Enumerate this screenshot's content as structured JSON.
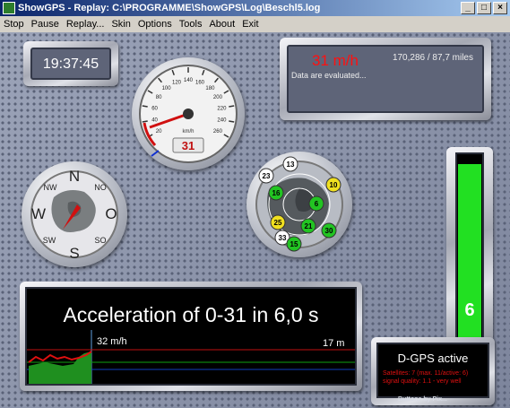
{
  "window": {
    "title": "ShowGPS - Replay: C:\\PROGRAMME\\ShowGPS\\Log\\Beschl5.log",
    "buttons": {
      "minimize": "_",
      "maximize": "□",
      "close": "×"
    }
  },
  "menu": {
    "items": [
      "Stop",
      "Pause",
      "Replay...",
      "Skin",
      "Options",
      "Tools",
      "About",
      "Exit"
    ]
  },
  "clock": {
    "time": "19:37:45"
  },
  "info": {
    "speed": "31 m/h",
    "odometer": "170,286 / 87,7 miles",
    "status": "Data are evaluated..."
  },
  "speedometer": {
    "ticks": [
      "20",
      "40",
      "60",
      "80",
      "100",
      "120",
      "140",
      "160",
      "180",
      "200",
      "220",
      "240",
      "260"
    ],
    "unit": "km/h",
    "readout": "31"
  },
  "compass": {
    "labels": {
      "n": "N",
      "s": "S",
      "w": "W",
      "o": "O",
      "nw": "NW",
      "no": "NO",
      "sw": "SW",
      "so": "SO"
    }
  },
  "satellites": {
    "items": [
      {
        "id": "13",
        "color": "#ffffff"
      },
      {
        "id": "23",
        "color": "#ffffff"
      },
      {
        "id": "16",
        "color": "#22c422"
      },
      {
        "id": "10",
        "color": "#f0e020"
      },
      {
        "id": "6",
        "color": "#22c422"
      },
      {
        "id": "25",
        "color": "#f0e020"
      },
      {
        "id": "21",
        "color": "#22c422"
      },
      {
        "id": "30",
        "color": "#22c422"
      },
      {
        "id": "33",
        "color": "#ffffff"
      },
      {
        "id": "15",
        "color": "#22c422"
      }
    ]
  },
  "acceleration": {
    "headline": "Acceleration of 0-31 in 6,0 s",
    "graph_speed_label": "32 m/h",
    "graph_distance_label": "17 m"
  },
  "signal_bar": {
    "value": "6",
    "level": 0.95,
    "color": "#22e022"
  },
  "dgps": {
    "title": "D-GPS active",
    "satellites_line": "Satellites: 7 (max. 11/active: 6)",
    "quality_line": "signal quality: 1.1 - very well",
    "overlay": "Buttons by Pix..."
  }
}
